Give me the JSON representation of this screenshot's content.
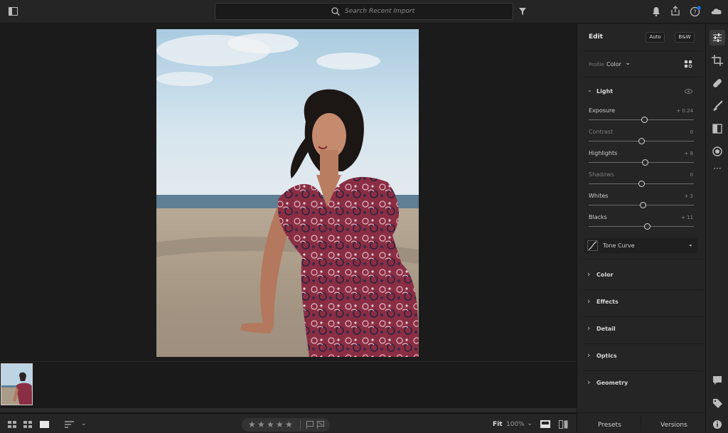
{
  "search": {
    "placeholder": "Search Recent Import"
  },
  "panel": {
    "title": "Edit",
    "auto_label": "Auto",
    "bw_label": "B&W",
    "profile_label": "Profile",
    "profile_value": "Color",
    "light": {
      "title": "Light",
      "sliders": [
        {
          "label": "Exposure",
          "value": "+ 0.24",
          "level": 0.53,
          "active": true
        },
        {
          "label": "Contrast",
          "value": "0",
          "level": 0.5,
          "active": false
        },
        {
          "label": "Highlights",
          "value": "+ 8",
          "level": 0.54,
          "active": true
        },
        {
          "label": "Shadows",
          "value": "0",
          "level": 0.5,
          "active": false
        },
        {
          "label": "Whites",
          "value": "+ 3",
          "level": 0.52,
          "active": true
        },
        {
          "label": "Blacks",
          "value": "+ 11",
          "level": 0.56,
          "active": true
        }
      ],
      "tone_curve_label": "Tone Curve"
    },
    "sections": [
      "Color",
      "Effects",
      "Detail",
      "Optics",
      "Geometry"
    ],
    "presets_label": "Presets",
    "versions_label": "Versions"
  },
  "bottombar": {
    "fit_label": "Fit",
    "zoom_value": "100%"
  },
  "colors": {
    "background": "#1e1e1e",
    "panel": "#252525",
    "accent": "#1473e6",
    "dress": "#8a2e43"
  }
}
